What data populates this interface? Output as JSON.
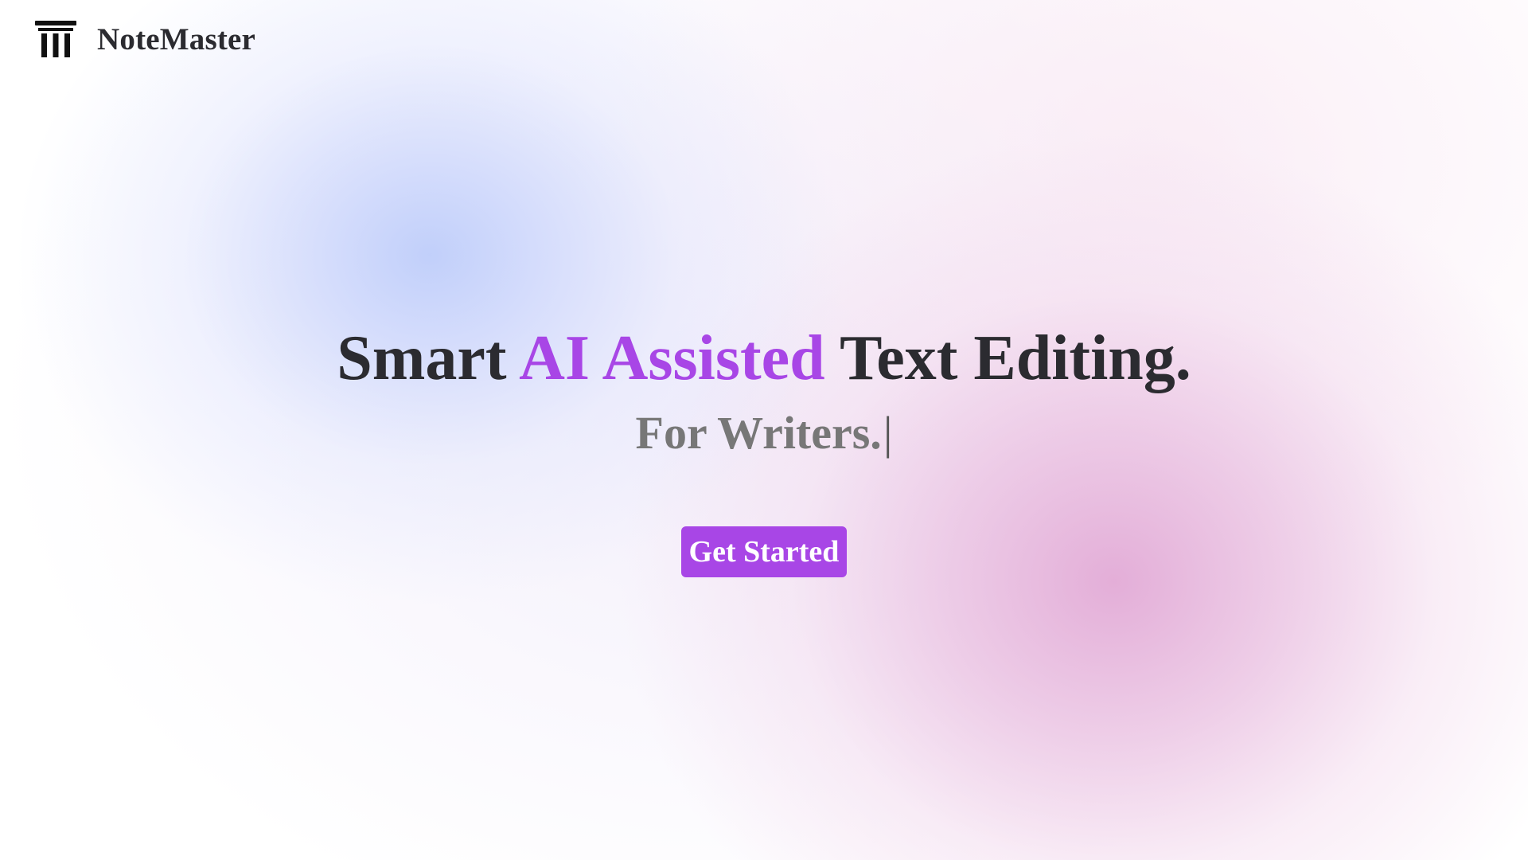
{
  "brand": {
    "name": "NoteMaster",
    "logo_icon": "pillars-icon"
  },
  "hero": {
    "headline_start": "Smart ",
    "headline_accent": "AI Assisted",
    "headline_end": " Text Editing.",
    "subline": "For Writers.",
    "cursor": "|"
  },
  "cta": {
    "label": "Get Started"
  },
  "colors": {
    "accent": "#a846e6",
    "text_dark": "#2b2b30",
    "text_muted": "#777777"
  }
}
